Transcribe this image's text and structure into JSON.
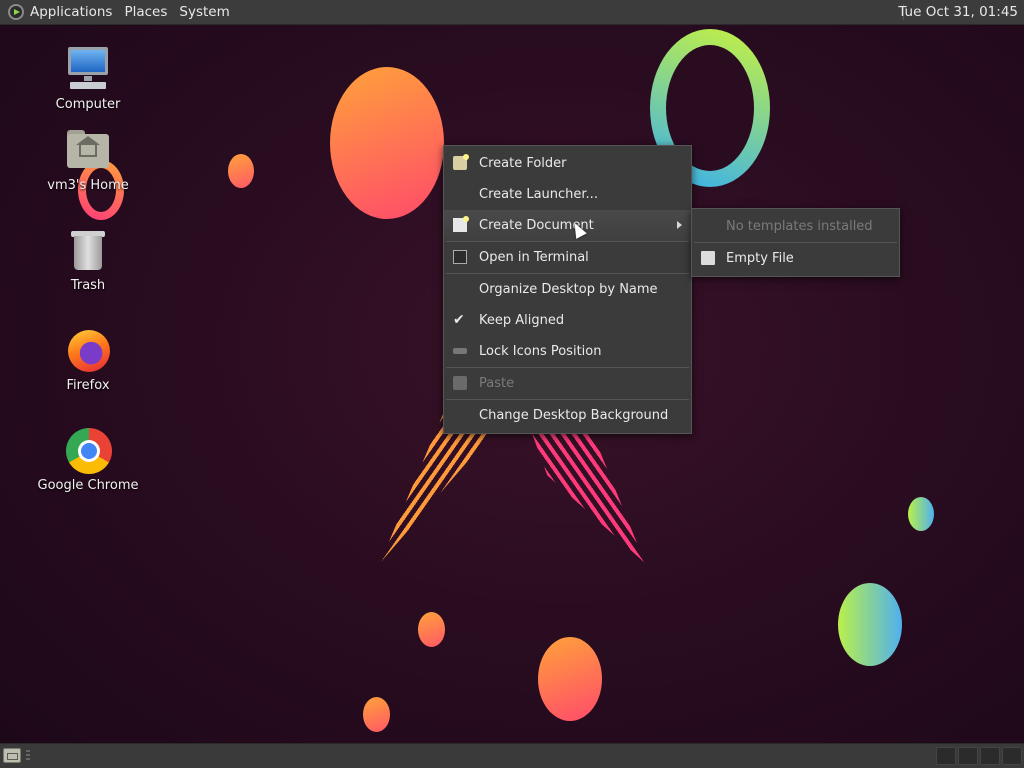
{
  "top_panel": {
    "menus": [
      "Applications",
      "Places",
      "System"
    ],
    "clock": "Tue Oct 31, 01:45"
  },
  "desktop_icons": [
    {
      "label": "Computer",
      "icon": "computer-icon"
    },
    {
      "label": "vm3's Home",
      "icon": "home-folder-icon"
    },
    {
      "label": "Trash",
      "icon": "trash-icon"
    },
    {
      "label": "Firefox",
      "icon": "firefox-icon"
    },
    {
      "label": "Google Chrome",
      "icon": "chrome-icon"
    }
  ],
  "context_menu": {
    "items": [
      {
        "label": "Create Folder",
        "icon": "folder-new-icon"
      },
      {
        "label": "Create Launcher...",
        "icon": ""
      },
      {
        "label": "Create Document",
        "icon": "document-new-icon",
        "submenu": true,
        "active": true
      },
      {
        "label": "Open in Terminal",
        "icon": "terminal-icon"
      },
      {
        "label": "Organize Desktop by Name",
        "icon": ""
      },
      {
        "label": "Keep Aligned",
        "icon": "check-icon",
        "checked": true
      },
      {
        "label": "Lock Icons Position",
        "icon": "lock-icon"
      },
      {
        "label": "Paste",
        "icon": "paste-icon",
        "disabled": true
      },
      {
        "label": "Change Desktop Background",
        "icon": ""
      }
    ]
  },
  "submenu": {
    "items": [
      {
        "label": "No templates installed",
        "disabled": true
      },
      {
        "label": "Empty File",
        "icon": "file-icon"
      }
    ]
  },
  "colors": {
    "panel_bg": "#3c3c3c",
    "menu_bg": "#3b3b3b",
    "desktop_bg": "#2a0c20"
  }
}
